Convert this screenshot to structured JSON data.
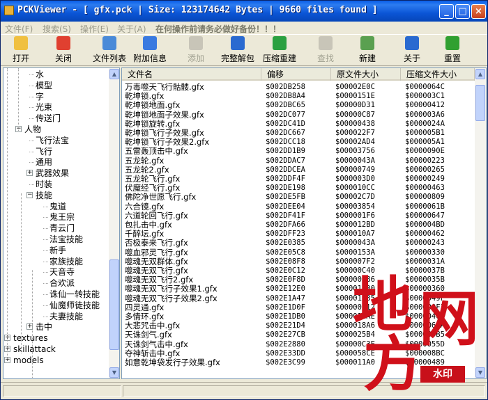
{
  "window": {
    "title": "PCKViewer - [ gfx.pck | Size: 123174642 Bytes | 9660 files found ]",
    "controls": {
      "minimize": "_",
      "maximize": "□",
      "close": "×"
    }
  },
  "menu": {
    "items": [
      "文件(F)",
      "搜索(S)",
      "操作(E)",
      "关于(A)"
    ],
    "warning": "在何操作前请务必做好备份！！！"
  },
  "toolbar": {
    "buttons": [
      {
        "label": "打开",
        "icon": "folder-open-icon",
        "color": "#f0c040",
        "enabled": true
      },
      {
        "label": "关闭",
        "icon": "close-file-icon",
        "color": "#e04030",
        "enabled": true
      },
      {
        "label": "文件列表",
        "icon": "file-list-icon",
        "color": "#4a8ad8",
        "enabled": true
      },
      {
        "label": "附加信息",
        "icon": "info-icon",
        "color": "#3a7ae0",
        "enabled": true
      },
      {
        "label": "添加",
        "icon": "add-icon",
        "color": "#c8c5b8",
        "enabled": false
      },
      {
        "label": "完整解包",
        "icon": "unpack-icon",
        "color": "#2a6ad0",
        "enabled": true
      },
      {
        "label": "压缩重建",
        "icon": "rebuild-icon",
        "color": "#2aa040",
        "enabled": true
      },
      {
        "label": "查找",
        "icon": "search-icon",
        "color": "#c8c5b8",
        "enabled": false
      },
      {
        "label": "新建",
        "icon": "new-icon",
        "color": "#5aa050",
        "enabled": true
      },
      {
        "label": "关于",
        "icon": "help-icon",
        "color": "#2a6ad0",
        "enabled": true
      },
      {
        "label": "重置",
        "icon": "reset-icon",
        "color": "#30a030",
        "enabled": true
      }
    ]
  },
  "tree": {
    "nodes": [
      {
        "label": "水",
        "level": 2
      },
      {
        "label": "模型",
        "level": 2
      },
      {
        "label": "字",
        "level": 2
      },
      {
        "label": "光束",
        "level": 2
      },
      {
        "label": "传送门",
        "level": 2
      },
      {
        "label": "人物",
        "level": 1,
        "expander": "−"
      },
      {
        "label": "飞行法宝",
        "level": 2
      },
      {
        "label": "飞行",
        "level": 2
      },
      {
        "label": "通用",
        "level": 2
      },
      {
        "label": "武器效果",
        "level": 2,
        "expander": "+"
      },
      {
        "label": "时装",
        "level": 2
      },
      {
        "label": "技能",
        "level": 2,
        "expander": "−"
      },
      {
        "label": "鬼道",
        "level": 3
      },
      {
        "label": "鬼王宗",
        "level": 3
      },
      {
        "label": "青云门",
        "level": 3
      },
      {
        "label": "法宝技能",
        "level": 3
      },
      {
        "label": "新手",
        "level": 3
      },
      {
        "label": "家族技能",
        "level": 3
      },
      {
        "label": "天音寺",
        "level": 3
      },
      {
        "label": "合欢派",
        "level": 3
      },
      {
        "label": "诛仙一转技能",
        "level": 3
      },
      {
        "label": "仙魔师徒技能",
        "level": 3
      },
      {
        "label": "夫妻技能",
        "level": 3
      },
      {
        "label": "击中",
        "level": 2,
        "expander": "+"
      },
      {
        "label": "textures",
        "level": 0,
        "expander": "+"
      },
      {
        "label": "skillattack",
        "level": 0,
        "expander": "+"
      },
      {
        "label": "models",
        "level": 0,
        "expander": "+"
      }
    ]
  },
  "list": {
    "columns": [
      "文件名",
      "偏移",
      "原文件大小",
      "压缩文件大小"
    ],
    "rows": [
      [
        "万毒噬天飞行骷髅.gfx",
        "$002DB258",
        "$00002E0C",
        "$0000064C"
      ],
      [
        "乾坤锁.gfx",
        "$002DB8A4",
        "$0000151E",
        "$000003C1"
      ],
      [
        "乾坤锁地面.gfx",
        "$002DBC65",
        "$00000D31",
        "$00000412"
      ],
      [
        "乾坤锁地面子效果.gfx",
        "$002DC077",
        "$00000C87",
        "$000003A6"
      ],
      [
        "乾坤锁旋转.gfx",
        "$002DC41D",
        "$00000438",
        "$0000024A"
      ],
      [
        "乾坤锁飞行子效果.gfx",
        "$002DC667",
        "$000022F7",
        "$000005B1"
      ],
      [
        "乾坤锁飞行子效果2.gfx",
        "$002DCC18",
        "$00002AD4",
        "$000005A1"
      ],
      [
        "五雷轰顶击中.gfx",
        "$002DD1B9",
        "$00003756",
        "$0000090E"
      ],
      [
        "五龙轮.gfx",
        "$002DDAC7",
        "$0000043A",
        "$00000223"
      ],
      [
        "五龙轮2.gfx",
        "$002DDCEA",
        "$00000749",
        "$00000265"
      ],
      [
        "五龙轮飞行.gfx",
        "$002DDF4F",
        "$000003D0",
        "$00000249"
      ],
      [
        "伏魔经飞行.gfx",
        "$002DE198",
        "$000010CC",
        "$00000463"
      ],
      [
        "佛陀净世愿飞行.gfx",
        "$002DE5FB",
        "$00002C7D",
        "$00000809"
      ],
      [
        "六合镜.gfx",
        "$002DEE04",
        "$00003854",
        "$0000061B"
      ],
      [
        "六道轮回飞行.gfx",
        "$002DF41F",
        "$000001F6",
        "$00000647"
      ],
      [
        "包扎击中.gfx",
        "$002DFA66",
        "$000012BD",
        "$000004BD"
      ],
      [
        "千醉坛.gfx",
        "$002DFF23",
        "$000010A7",
        "$00000462"
      ],
      [
        "否极泰来飞行.gfx",
        "$002E0385",
        "$0000043A",
        "$00000243"
      ],
      [
        "噬血邪灵飞行.gfx",
        "$002E05C8",
        "$0000153A",
        "$00000330"
      ],
      [
        "噬魂无双群体.gfx",
        "$002E08F8",
        "$000007F2",
        "$0000031A"
      ],
      [
        "噬魂无双飞行.gfx",
        "$002E0C12",
        "$00000C40",
        "$0000037B"
      ],
      [
        "噬魂无双飞行2.gfx",
        "$002E0F8D",
        "$00000F86",
        "$0000035B"
      ],
      [
        "噬魂无双飞行子效果1.gfx",
        "$002E12E0",
        "$00001000",
        "$00000360"
      ],
      [
        "噬魂无双飞行子效果2.gfx",
        "$002E1A47",
        "$00001E35",
        "$0000049F"
      ],
      [
        "四灵通.gfx",
        "$002E1D0F",
        "$00000112",
        "$000000F3"
      ],
      [
        "多情环.gfx",
        "$002E1DB0",
        "$000012AE",
        "$00000464"
      ],
      [
        "大悲咒击中.gfx",
        "$002E21D4",
        "$000018A6",
        "$0000066A"
      ],
      [
        "天诛剑气.gfx",
        "$002E27CB",
        "$000025B4",
        "$000006B5"
      ],
      [
        "天诛剑气击中.gfx",
        "$002E2880",
        "$00000C3E",
        "$0000055D"
      ],
      [
        "夺神斩击中.gfx",
        "$002E33DD",
        "$000058CE",
        "$000008BC"
      ],
      [
        "如意乾坤袋发行子效果.gfx",
        "$002E3C99",
        "$000011A0",
        "$00000489"
      ]
    ]
  },
  "watermark": {
    "chars": [
      "地",
      "方",
      "网"
    ],
    "seal": "水印"
  }
}
